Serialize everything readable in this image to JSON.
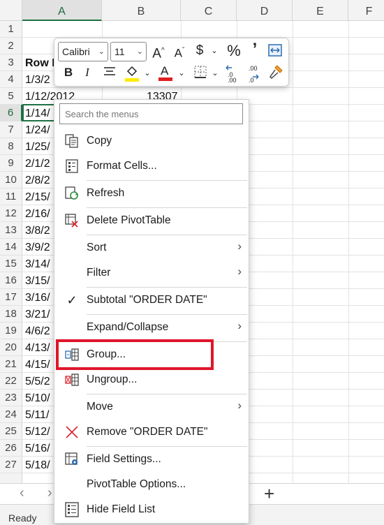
{
  "spreadsheet": {
    "columns": [
      "A",
      "B",
      "C",
      "D",
      "E",
      "F"
    ],
    "rows": [
      "1",
      "2",
      "3",
      "4",
      "5",
      "6",
      "7",
      "8",
      "9",
      "10",
      "11",
      "12",
      "13",
      "14",
      "15",
      "16",
      "17",
      "18",
      "19",
      "20",
      "21",
      "22",
      "23",
      "24",
      "25",
      "26",
      "27"
    ],
    "cells": {
      "a3": "Row L",
      "a4": "1/3/2",
      "a5": "1/12/2012",
      "b5": "13307",
      "a6": "1/14/",
      "a7": "1/24/",
      "a8": "1/25/",
      "a9": "2/1/2",
      "a10": "2/8/2",
      "a11": "2/15/",
      "a12": "2/16/",
      "a13": "3/8/2",
      "a14": "3/9/2",
      "a15": "3/14/",
      "a16": "3/15/",
      "a17": "3/16/",
      "a18": "3/21/",
      "a19": "4/6/2",
      "a20": "4/13/",
      "a21": "4/15/",
      "a22": "5/5/2",
      "a23": "5/10/",
      "a24": "5/11/",
      "a25": "5/12/",
      "a26": "5/16/",
      "a27": "5/18/"
    },
    "selected_column": "A",
    "selected_row": "6"
  },
  "mini_toolbar": {
    "font_name": "Calibri",
    "font_size": "11"
  },
  "context_menu": {
    "search_placeholder": "Search the menus",
    "items": {
      "copy": "Copy",
      "format_cells": "Format Cells...",
      "refresh": "Refresh",
      "delete_pivot": "Delete PivotTable",
      "sort": "Sort",
      "filter": "Filter",
      "subtotal": "Subtotal \"ORDER DATE\"",
      "expand_collapse": "Expand/Collapse",
      "group": "Group...",
      "ungroup": "Ungroup...",
      "move": "Move",
      "remove": "Remove \"ORDER DATE\"",
      "field_settings": "Field Settings...",
      "pivot_options": "PivotTable Options...",
      "hide_field_list": "Hide Field List"
    }
  },
  "sheet_tabs": {
    "add_sheet": "+"
  },
  "status_bar": {
    "ready": "Ready"
  },
  "colors": {
    "accent": "#1e7145",
    "highlight_box": "#e0162b"
  }
}
